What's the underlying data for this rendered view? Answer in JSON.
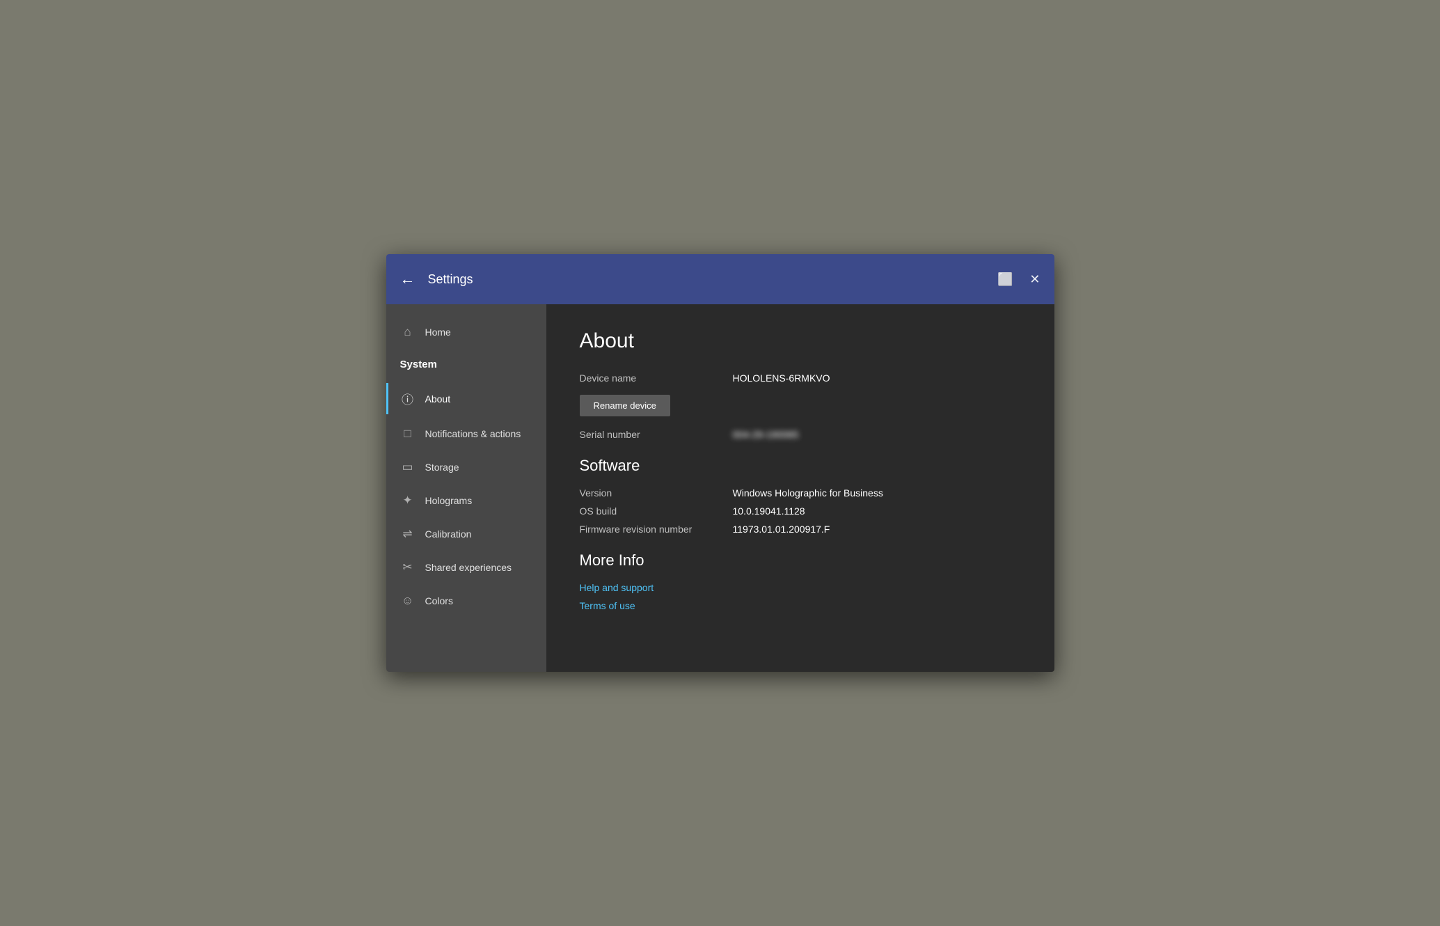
{
  "titlebar": {
    "back_label": "←",
    "title": "Settings",
    "window_icon": "⬜",
    "close_icon": "✕"
  },
  "sidebar": {
    "items": [
      {
        "id": "home",
        "label": "Home",
        "icon": "⌂",
        "type": "nav"
      },
      {
        "id": "system",
        "label": "System",
        "icon": "",
        "type": "header"
      },
      {
        "id": "about",
        "label": "About",
        "icon": "ℹ",
        "type": "nav",
        "active": true
      },
      {
        "id": "notifications",
        "label": "Notifications & actions",
        "icon": "🖥",
        "type": "nav"
      },
      {
        "id": "storage",
        "label": "Storage",
        "icon": "⊟",
        "type": "nav"
      },
      {
        "id": "holograms",
        "label": "Holograms",
        "icon": "✦",
        "type": "nav"
      },
      {
        "id": "calibration",
        "label": "Calibration",
        "icon": "⇌",
        "type": "nav"
      },
      {
        "id": "shared",
        "label": "Shared experiences",
        "icon": "✂",
        "type": "nav"
      },
      {
        "id": "colors",
        "label": "Colors",
        "icon": "☺",
        "type": "nav"
      }
    ]
  },
  "content": {
    "page_title": "About",
    "device_name_label": "Device name",
    "device_name_value": "HOLOLENS-6RMKVO",
    "rename_btn_label": "Rename device",
    "serial_number_label": "Serial number",
    "serial_number_value": "004-29-190065",
    "software_section": "Software",
    "version_label": "Version",
    "version_value": "Windows Holographic for Business",
    "os_build_label": "OS build",
    "os_build_value": "10.0.19041.1128",
    "firmware_label": "Firmware revision number",
    "firmware_value": "11973.01.01.200917.F",
    "more_info_section": "More Info",
    "help_link": "Help and support",
    "terms_link": "Terms of use"
  }
}
